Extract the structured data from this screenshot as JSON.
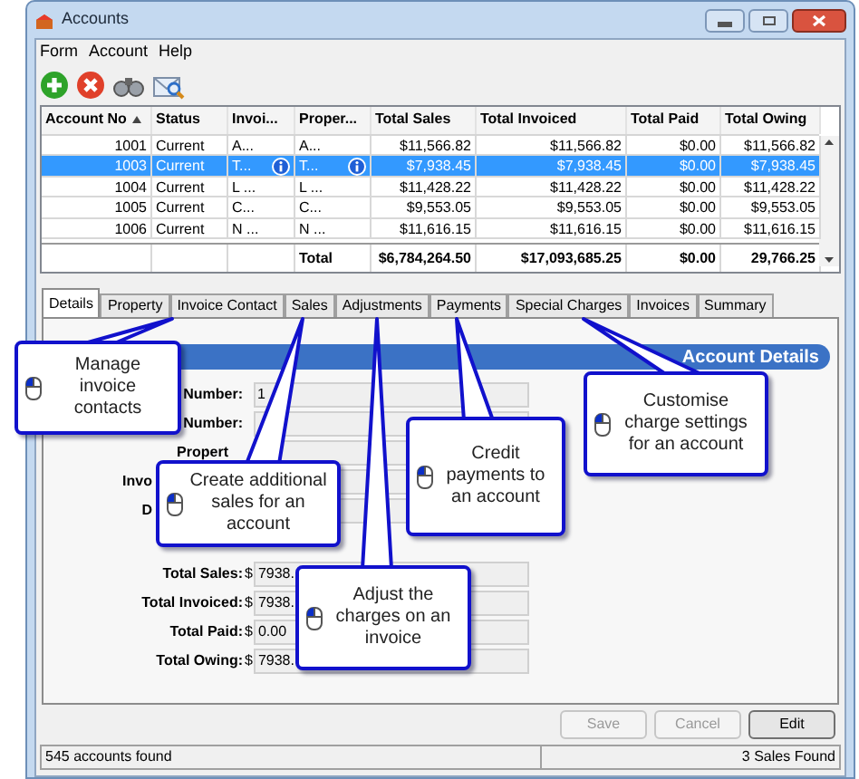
{
  "window": {
    "title": "Accounts"
  },
  "menu": [
    "Form",
    "Account",
    "Help"
  ],
  "table": {
    "columns": [
      "Account No",
      "Status",
      "Invoi...",
      "Proper...",
      "Total Sales",
      "Total Invoiced",
      "Total Paid",
      "Total Owing"
    ],
    "rows": [
      {
        "cells": [
          "1001",
          "Current",
          "A...",
          "A...",
          "$11,566.82",
          "$11,566.82",
          "$0.00",
          "$11,566.82"
        ],
        "selected": false,
        "info_icons": false
      },
      {
        "cells": [
          "1003",
          "Current",
          "T...",
          "T...",
          "$7,938.45",
          "$7,938.45",
          "$0.00",
          "$7,938.45"
        ],
        "selected": true,
        "info_icons": true
      },
      {
        "cells": [
          "1004",
          "Current",
          "L ...",
          "L ...",
          "$11,428.22",
          "$11,428.22",
          "$0.00",
          "$11,428.22"
        ],
        "selected": false,
        "info_icons": false
      },
      {
        "cells": [
          "1005",
          "Current",
          "C...",
          "C...",
          "$9,553.05",
          "$9,553.05",
          "$0.00",
          "$9,553.05"
        ],
        "selected": false,
        "info_icons": false
      },
      {
        "cells": [
          "1006",
          "Current",
          "N ...",
          "N ...",
          "$11,616.15",
          "$11,616.15",
          "$0.00",
          "$11,616.15"
        ],
        "selected": false,
        "info_icons": false
      }
    ],
    "total_row": {
      "label": "Total",
      "values": [
        "$6,784,264.50",
        "$17,093,685.25",
        "$0.00",
        "29,766.25"
      ]
    }
  },
  "tabs": [
    {
      "label": "Details",
      "selected": true
    },
    {
      "label": "Property",
      "selected": false
    },
    {
      "label": "Invoice Contact",
      "selected": false
    },
    {
      "label": "Sales",
      "selected": false
    },
    {
      "label": "Adjustments",
      "selected": false
    },
    {
      "label": "Payments",
      "selected": false
    },
    {
      "label": "Special Charges",
      "selected": false
    },
    {
      "label": "Invoices",
      "selected": false
    },
    {
      "label": "Summary",
      "selected": false
    }
  ],
  "section_title": "Account Details",
  "form": [
    {
      "label": "Number:",
      "value": "1"
    },
    {
      "label": "Number:"
    },
    {
      "label": "Propert"
    },
    {
      "label": "Invo"
    },
    {
      "label": "D"
    },
    {
      "label": "Total Sales:",
      "value": "7938."
    },
    {
      "label": "Total Invoiced:",
      "value": "7938."
    },
    {
      "label": "Total Paid:",
      "value": "0.00"
    },
    {
      "label": "Total Owing:",
      "value": "7938."
    }
  ],
  "currency": "$",
  "buttons": [
    {
      "label": "Save",
      "disabled": true
    },
    {
      "label": "Cancel",
      "disabled": true
    },
    {
      "label": "Edit",
      "disabled": false
    }
  ],
  "status_bar": [
    "545 accounts found",
    "3 Sales Found"
  ],
  "callouts": [
    {
      "text": "Manage invoice contacts"
    },
    {
      "text": "Create additional sales for an account"
    },
    {
      "text": "Adjust the charges on an invoice"
    },
    {
      "text": "Credit payments to an account"
    },
    {
      "text": "Customise charge settings for an account"
    }
  ]
}
